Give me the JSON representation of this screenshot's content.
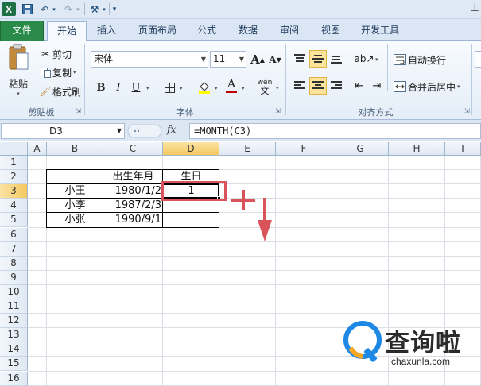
{
  "tabs": {
    "file": "文件",
    "home": "开始",
    "insert": "插入",
    "layout": "页面布局",
    "formulas": "公式",
    "data": "数据",
    "review": "审阅",
    "view": "视图",
    "developer": "开发工具"
  },
  "clipboard": {
    "paste": "粘贴",
    "cut": "剪切",
    "copy": "复制",
    "format_painter": "格式刷",
    "group_label": "剪贴板"
  },
  "font": {
    "name": "宋体",
    "size": "11",
    "bold": "B",
    "italic": "I",
    "underline": "U",
    "grow": "A",
    "shrink": "A",
    "color_glyph": "A",
    "phonetic": "wén",
    "group_label": "字体"
  },
  "alignment": {
    "wrap": "自动换行",
    "merge": "合并后居中",
    "group_label": "对齐方式"
  },
  "formula_bar": {
    "name_box": "D3",
    "fx": "fx",
    "formula": "=MONTH(C3)"
  },
  "columns": [
    "A",
    "B",
    "C",
    "D",
    "E",
    "F",
    "G",
    "H",
    "I"
  ],
  "rows": [
    "1",
    "2",
    "3",
    "4",
    "5",
    "6",
    "7",
    "8",
    "9",
    "10",
    "11",
    "12",
    "13",
    "14",
    "15",
    "16"
  ],
  "table": {
    "header_birth": "出生年月",
    "header_month": "生日",
    "names": [
      "小王",
      "小李",
      "小张"
    ],
    "dates": [
      "1980/1/2",
      "1987/2/3",
      "1990/9/1"
    ],
    "d3_value": "1"
  },
  "watermark": {
    "title": "查询啦",
    "url": "chaxunla.com"
  },
  "colors": {
    "file_tab": "#2a8a4a",
    "selection_header": "#f4c85f",
    "highlight_red": "#d9545a"
  }
}
